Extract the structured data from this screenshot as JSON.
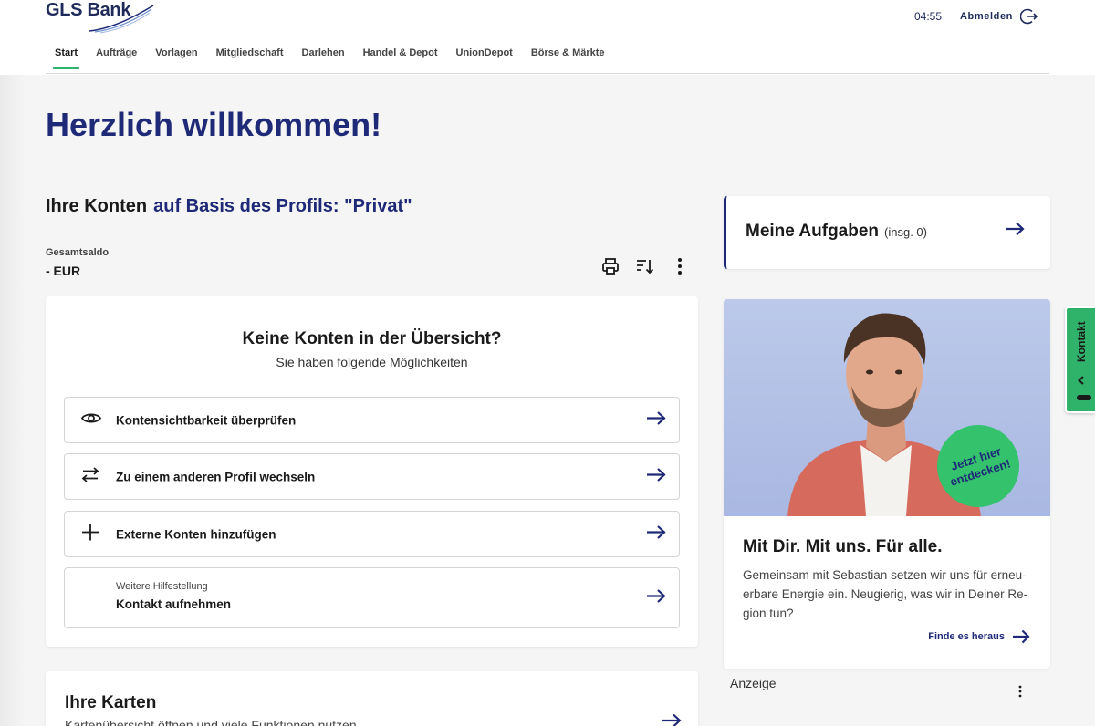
{
  "brand": {
    "name": "GLS Bank",
    "accent": "#1e2a78",
    "green": "#2fb36b"
  },
  "header": {
    "session_time": "04:55",
    "logout_label": "Abmelden",
    "nav": [
      {
        "label": "Start",
        "active": true
      },
      {
        "label": "Aufträge"
      },
      {
        "label": "Vorlagen"
      },
      {
        "label": "Mitgliedschaft"
      },
      {
        "label": "Darlehen"
      },
      {
        "label": "Handel & Depot"
      },
      {
        "label": "UnionDepot"
      },
      {
        "label": "Börse & Märkte"
      }
    ]
  },
  "main": {
    "title": "Herzlich willkommen!",
    "accounts_title": "Ihre Konten",
    "accounts_profile": "auf Basis des Profils: \"Privat\"",
    "total_label": "Gesamtsaldo",
    "total_value": "- EUR",
    "empty": {
      "title": "Keine Konten in der Übersicht?",
      "subtitle": "Sie haben folgende Möglichkeiten",
      "options": [
        {
          "label": "Kontensichtbarkeit überprüfen",
          "icon": "eye-icon"
        },
        {
          "label": "Zu einem anderen Profil wechseln",
          "icon": "swap-icon"
        },
        {
          "label": "Externe Konten hinzufügen",
          "icon": "plus-icon"
        }
      ],
      "help_small": "Weitere Hilfestellung",
      "help_label": "Kontakt aufnehmen"
    },
    "cards": {
      "title": "Ihre Karten",
      "subtitle": "Kartenübersicht öffnen und viele Funktionen nutzen"
    }
  },
  "sidebar": {
    "tasks_title": "Meine Aufgaben",
    "tasks_count": "(insg. 0)",
    "promo": {
      "badge": "Jetzt hier entdecken!",
      "title": "Mit Dir. Mit uns. Für alle.",
      "text": "Gemeinsam mit Sebastian setzen wir uns für erneu-erbare Energie ein. Neugierig, was wir in Deiner Re-gion tun?",
      "link": "Finde es heraus"
    },
    "ad_label": "Anzeige",
    "contact_label": "Kontakt"
  }
}
